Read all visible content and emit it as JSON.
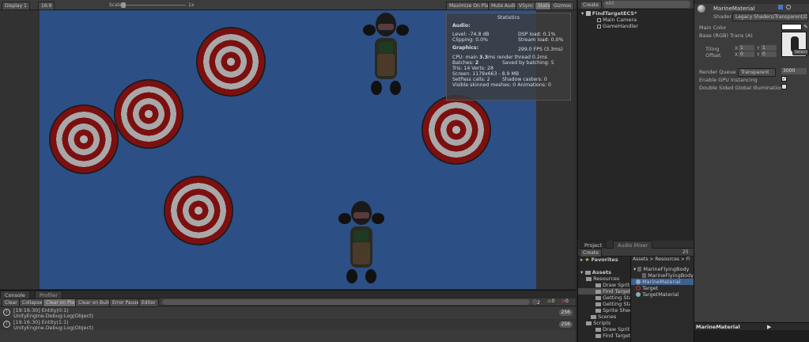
{
  "game_toolbar": {
    "display": "Display 1",
    "aspect": "16:9",
    "scale_label": "Scale",
    "scale_value": "1x",
    "buttons": [
      "Maximize On Play",
      "Mute Audio",
      "VSync",
      "Stats",
      "Gizmos"
    ]
  },
  "stats": {
    "title": "Statistics",
    "audio_header": "Audio:",
    "level": "Level: -74.8 dB",
    "clipping": "Clipping: 0.0%",
    "dsp": "DSP load: 0.1%",
    "stream": "Stream load: 0.0%",
    "graphics_header": "Graphics:",
    "fps": "299.0 FPS (3.3ms)",
    "cpu_label": "CPU: main",
    "cpu_value": "3.3",
    "cpu_rest": "ms  render thread 0.2ms",
    "batches_label": "Batches:",
    "batches_value": "2",
    "saved": "Saved by batching: 5",
    "tris": "Tris: 14   Verts: 28",
    "screen": "Screen: 1179x663 - 8.9 MB",
    "setpass": "SetPass calls: 2",
    "shadow": "Shadow casters: 0",
    "skinned": "Visible skinned meshes: 0   Animations: 0"
  },
  "hierarchy": {
    "create": "Create",
    "search": "▾All",
    "scene": "FindTargetECS*",
    "items": [
      "Main Camera",
      "GameHandler"
    ]
  },
  "project": {
    "tabs": [
      "Project",
      "Audio Mixer"
    ],
    "create": "Create",
    "count": "25",
    "favorites": "Favorites",
    "assets": "Assets",
    "tree": [
      "Resources",
      "Draw Sprit",
      "Find Target",
      "Getting Sta",
      "Getting Sta",
      "Sprite Shee",
      "Scenes",
      "Scripts",
      "Draw Sprit",
      "Find Target"
    ],
    "breadcrumb": "Assets > Resources > Fi",
    "files": [
      "MarineFlyingBody",
      "MarineFlyingBody",
      "MarineMaterial",
      "Target",
      "TargetMaterial"
    ]
  },
  "inspector": {
    "name": "MarineMaterial",
    "shader_label": "Shader",
    "shader_value": "Legacy Shaders/Transparent/D",
    "main_color": "Main Color",
    "base": "Base (RGB) Trans (A)",
    "tiling": "Tiling",
    "offset": "Offset",
    "tiling_x": "1",
    "tiling_y": "1",
    "offset_x": "0",
    "offset_y": "0",
    "x_label": "X",
    "y_label": "Y",
    "select": "Select",
    "render_queue": "Render Queue",
    "render_queue_mode": "Transparent",
    "render_queue_value": "3000",
    "gpu": "Enable GPU Instancing",
    "double": "Double Sided Global Illumination",
    "preview": "MarineMaterial"
  },
  "console": {
    "tabs": [
      "Console",
      "Profiler"
    ],
    "buttons": [
      "Clear",
      "Collapse",
      "Clear on Play",
      "Clear on Build",
      "Error Pause",
      "Editor"
    ],
    "counts": [
      "2",
      "0",
      "0"
    ],
    "logs": [
      {
        "line1": "[19:16:30] Entity(0:1)",
        "line2": "UnityEngine.Debug:Log(Object)",
        "count": "256"
      },
      {
        "line1": "[19:16:30] Entity(1:1)",
        "line2": "UnityEngine.Debug:Log(Object)",
        "count": "256"
      }
    ]
  }
}
